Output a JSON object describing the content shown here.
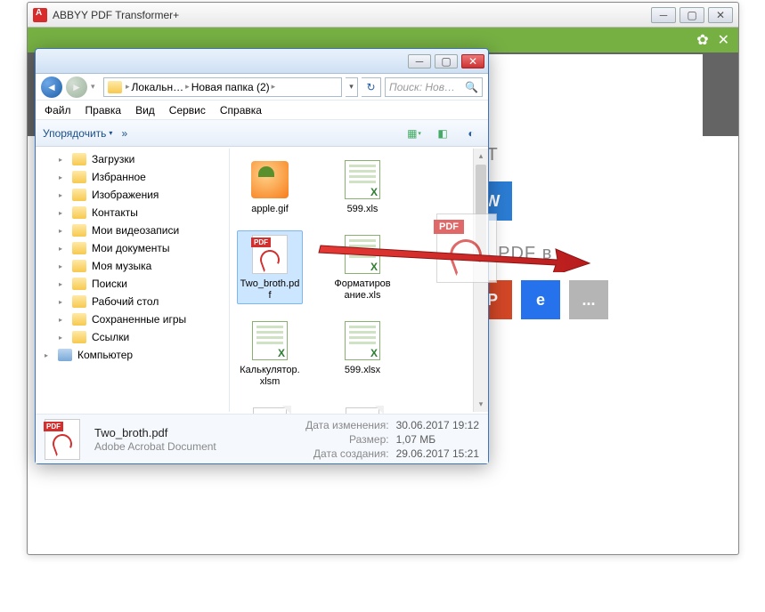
{
  "app": {
    "title": "ABBYY PDF Transformer+"
  },
  "explorer": {
    "breadcrumb": [
      "Локальн…",
      "Новая папка (2)"
    ],
    "search_placeholder": "Поиск: Нов…",
    "menu": [
      "Файл",
      "Правка",
      "Вид",
      "Сервис",
      "Справка"
    ],
    "toolbar": {
      "organize": "Упорядочить",
      "more": "»"
    },
    "tree": [
      "Загрузки",
      "Избранное",
      "Изображения",
      "Контакты",
      "Мои видеозаписи",
      "Мои документы",
      "Моя музыка",
      "Поиски",
      "Рабочий стол",
      "Сохраненные игры",
      "Ссылки"
    ],
    "tree_computer": "Компьютер",
    "files": [
      {
        "name": "apple.gif",
        "icon": "img",
        "selected": false
      },
      {
        "name": "599.xls",
        "icon": "xls",
        "selected": false
      },
      {
        "name": "Two_broth.pdf",
        "icon": "pdf",
        "selected": true
      },
      {
        "name": "Форматирование.xls",
        "icon": "xls",
        "selected": false
      },
      {
        "name": "Калькулятор.xlsm",
        "icon": "xls",
        "selected": false
      },
      {
        "name": "599.xlsx",
        "icon": "xls",
        "selected": false
      },
      {
        "name": "",
        "icon": "blank",
        "selected": false
      },
      {
        "name": "",
        "icon": "blank",
        "selected": false
      }
    ],
    "details": {
      "filename": "Two_broth.pdf",
      "filetype": "Adobe Acrobat Document",
      "modified_label": "Дата изменения:",
      "modified": "30.06.2017 19:12",
      "size_label": "Размер:",
      "size": "1,07 МБ",
      "created_label": "Дата создания:",
      "created": "29.06.2017 15:21"
    }
  },
  "dropzone": {
    "title1_suffix": "НТ",
    "title2_prefix": "ть PDF в",
    "tiles_row2": [
      "P",
      "e",
      "..."
    ]
  },
  "drag": {
    "badge": "PDF"
  }
}
